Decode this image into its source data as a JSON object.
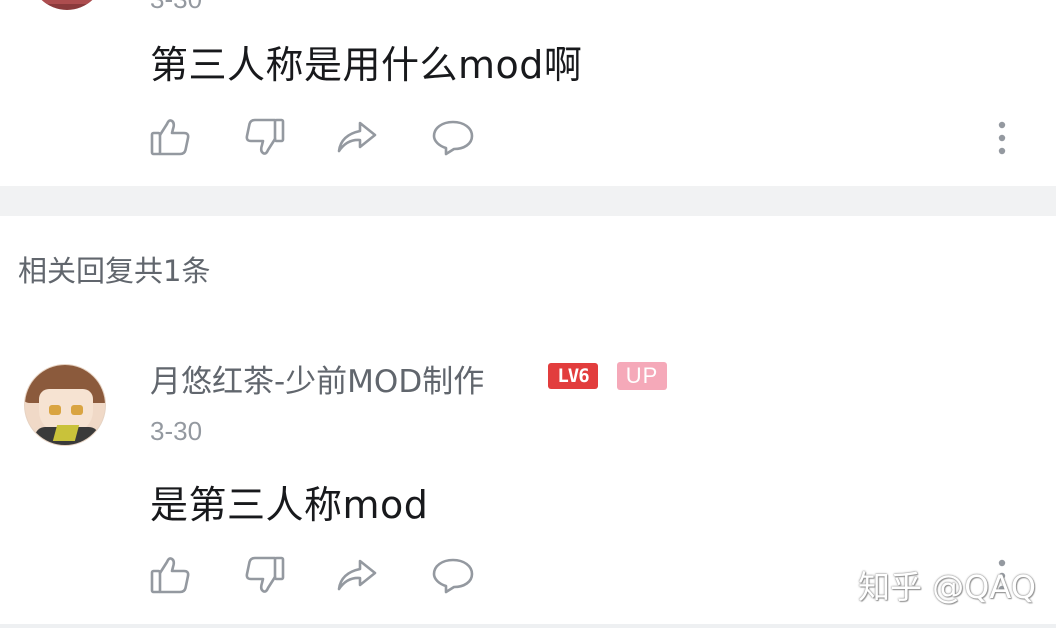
{
  "top_comment": {
    "date": "3-30",
    "text": "第三人称是用什么mod啊",
    "actions": [
      "like-icon",
      "dislike-icon",
      "share-icon",
      "reply-icon",
      "more-icon"
    ]
  },
  "replies_section": {
    "header": "相关回复共1条"
  },
  "reply": {
    "username": "月悠红茶-少前MOD制作",
    "level_badge": "LV6",
    "up_badge": "UP",
    "date": "3-30",
    "text": "是第三人称mod",
    "actions": [
      "like-icon",
      "dislike-icon",
      "share-icon",
      "reply-icon",
      "more-icon"
    ]
  },
  "watermark": "知乎 @QAQ",
  "colors": {
    "text_primary": "#18191c",
    "text_secondary": "#61666d",
    "text_muted": "#9499a0",
    "icon_gray": "#9499a0",
    "level_red": "#e23d3d",
    "up_pink": "#f5a9b9",
    "separator": "#f1f2f3"
  }
}
